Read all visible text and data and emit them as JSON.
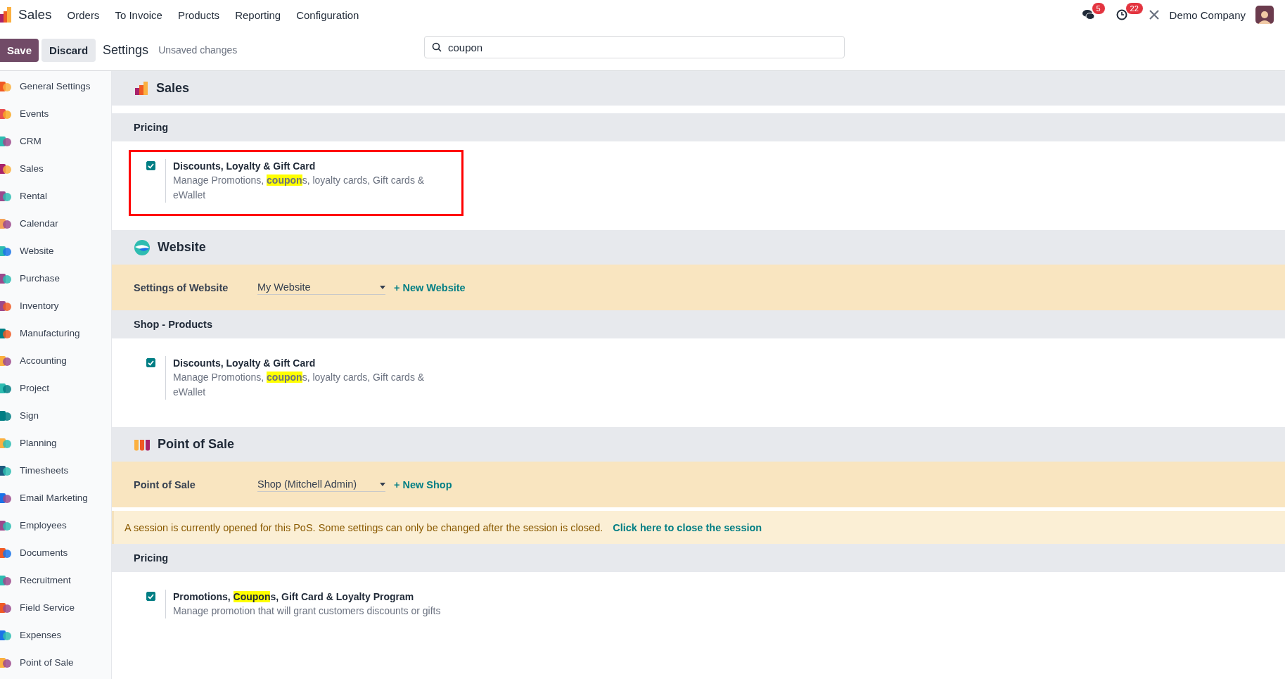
{
  "navbar": {
    "app": "Sales",
    "menu": [
      "Orders",
      "To Invoice",
      "Products",
      "Reporting",
      "Configuration"
    ],
    "messages_badge": "5",
    "activities_badge": "22",
    "company": "Demo Company"
  },
  "control_bar": {
    "save": "Save",
    "discard": "Discard",
    "title": "Settings",
    "status": "Unsaved changes",
    "search": {
      "value": "coupon"
    }
  },
  "sidebar": {
    "items": [
      {
        "label": "General Settings",
        "selected": false
      },
      {
        "label": "Events",
        "selected": false
      },
      {
        "label": "CRM",
        "selected": false
      },
      {
        "label": "Sales",
        "selected": false
      },
      {
        "label": "Rental",
        "selected": false
      },
      {
        "label": "Calendar",
        "selected": false
      },
      {
        "label": "Website",
        "selected": false
      },
      {
        "label": "Purchase",
        "selected": false
      },
      {
        "label": "Inventory",
        "selected": false
      },
      {
        "label": "Manufacturing",
        "selected": false
      },
      {
        "label": "Accounting",
        "selected": false
      },
      {
        "label": "Project",
        "selected": false
      },
      {
        "label": "Sign",
        "selected": false
      },
      {
        "label": "Planning",
        "selected": false
      },
      {
        "label": "Timesheets",
        "selected": false
      },
      {
        "label": "Email Marketing",
        "selected": false
      },
      {
        "label": "Employees",
        "selected": false
      },
      {
        "label": "Documents",
        "selected": false
      },
      {
        "label": "Recruitment",
        "selected": false
      },
      {
        "label": "Field Service",
        "selected": false
      },
      {
        "label": "Expenses",
        "selected": false
      },
      {
        "label": "Point of Sale",
        "selected": false
      }
    ]
  },
  "sections": [
    {
      "title": "Sales",
      "blocks": [
        {
          "kind": "subheader",
          "title": "Pricing"
        },
        {
          "kind": "setting",
          "outlined": true,
          "checked": true,
          "title": [
            {
              "text": "Discounts, Loyalty & Gift Card",
              "highlight": false
            }
          ],
          "description": [
            {
              "text": "Manage Promotions, ",
              "highlight": false
            },
            {
              "text": "coupon",
              "highlight": true
            },
            {
              "text": "s, loyalty cards, Gift cards & eWallet",
              "highlight": false
            }
          ]
        }
      ]
    },
    {
      "title": "Website",
      "blocks": [
        {
          "kind": "selector",
          "label": "Settings of Website",
          "value": "My Website",
          "link": "+ New Website"
        },
        {
          "kind": "subheader",
          "title": "Shop - Products"
        },
        {
          "kind": "setting",
          "outlined": false,
          "checked": true,
          "title": [
            {
              "text": "Discounts, Loyalty & Gift Card",
              "highlight": false
            }
          ],
          "description": [
            {
              "text": "Manage Promotions, ",
              "highlight": false
            },
            {
              "text": "coupon",
              "highlight": true
            },
            {
              "text": "s, loyalty cards, Gift cards & eWallet",
              "highlight": false
            }
          ]
        }
      ]
    },
    {
      "title": "Point of Sale",
      "blocks": [
        {
          "kind": "selector",
          "label": "Point of Sale",
          "value": "Shop (Mitchell Admin)",
          "link": "+ New Shop"
        },
        {
          "kind": "alert",
          "text": "A session is currently opened for this PoS. Some settings can only be changed after the session is closed.",
          "link": "Click here to close the session"
        },
        {
          "kind": "subheader",
          "title": "Pricing"
        },
        {
          "kind": "setting",
          "outlined": false,
          "checked": true,
          "title": [
            {
              "text": "Promotions, ",
              "highlight": false
            },
            {
              "text": "Coupon",
              "highlight": true
            },
            {
              "text": "s, Gift Card & Loyalty Program",
              "highlight": false
            }
          ],
          "description": [
            {
              "text": "Manage promotion that will grant customers discounts or gifts",
              "highlight": false
            }
          ]
        }
      ]
    }
  ]
}
